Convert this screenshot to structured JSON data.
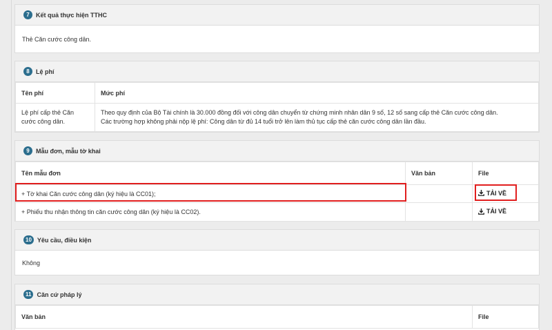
{
  "sections": {
    "result": {
      "number": "7",
      "title": "Kết quả thực hiện TTHC",
      "text": "Thẻ Căn cước công dân."
    },
    "fee": {
      "number": "8",
      "title": "Lệ phí",
      "headers": [
        "Tên phí",
        "Mức phí"
      ],
      "row": {
        "name": "Lệ phí cấp thẻ Căn cước công dân.",
        "line1": "Theo quy định của Bộ Tài chính là 30.000 đồng đối với công dân chuyển từ chứng minh nhân dân 9 số, 12 số sang cấp thẻ Căn cước công dân.",
        "line2": "Các trường hợp không phải nộp lệ phí: Công dân từ đủ 14 tuổi trở lên làm thủ tục cấp thẻ căn cước công dân lần đầu."
      }
    },
    "forms": {
      "number": "9",
      "title": "Mẫu đơn, mẫu tờ khai",
      "headers": [
        "Tên mẫu đơn",
        "Văn bản",
        "File"
      ],
      "rows": [
        {
          "name": "+ Tờ khai Căn cước công dân (ký hiệu là CC01);",
          "doc": "",
          "download": "TẢI VỀ"
        },
        {
          "name": "+ Phiếu thu nhận thông tin căn cước công dân (ký hiệu là CC02).",
          "doc": "",
          "download": "TẢI VỀ"
        }
      ]
    },
    "requirements": {
      "number": "10",
      "title": "Yêu cầu, điều kiện",
      "text": "Không"
    },
    "legal": {
      "number": "11",
      "title": "Căn cứ pháp lý",
      "headers": [
        "Văn bản",
        "File"
      ]
    }
  },
  "highlight_color": "#e11d1d",
  "badge_color": "#2c6e8e"
}
